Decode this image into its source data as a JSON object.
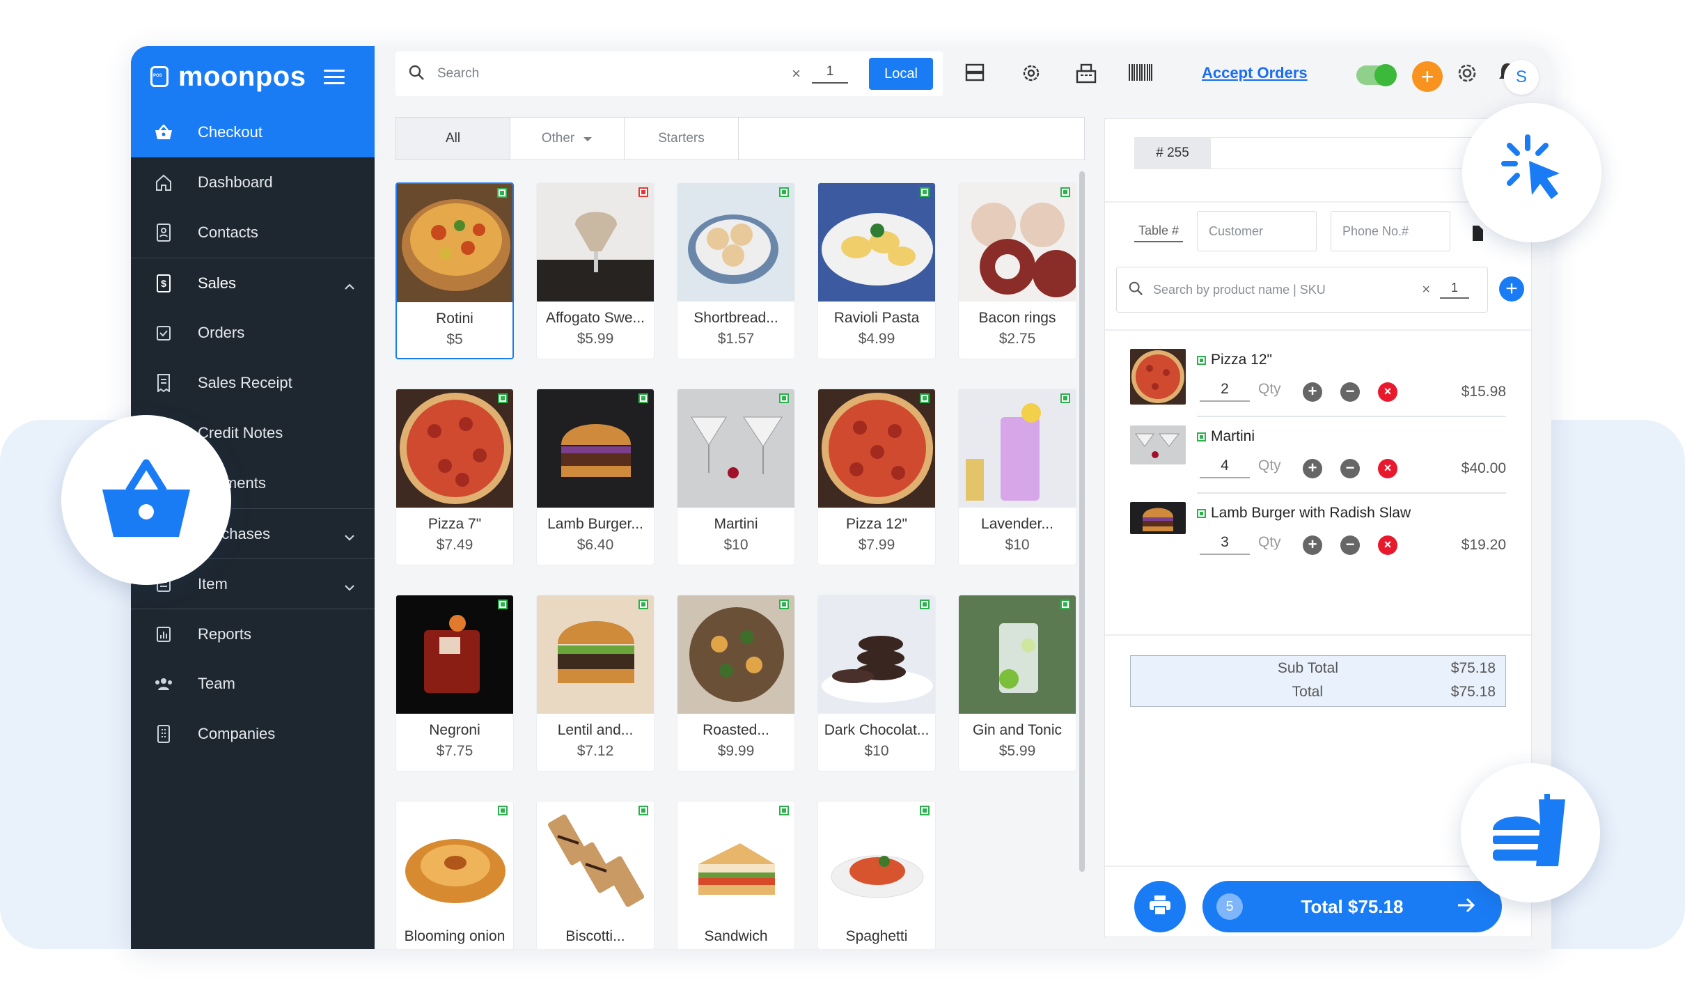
{
  "app": {
    "logo": "moonpos",
    "logo_badge": "POS"
  },
  "sidebar": {
    "items": [
      {
        "label": "Checkout",
        "icon": "basket-icon"
      },
      {
        "label": "Dashboard",
        "icon": "home-icon"
      },
      {
        "label": "Contacts",
        "icon": "contacts-icon"
      },
      {
        "label": "Sales",
        "icon": "dollar-doc-icon"
      },
      {
        "label": "Orders",
        "icon": "checkbox-icon"
      },
      {
        "label": "Sales Receipt",
        "icon": "receipt-icon"
      },
      {
        "label": "Credit Notes",
        "icon": "note-icon"
      },
      {
        "label": "Payments",
        "icon": "payments-icon"
      },
      {
        "label": "Purchases",
        "icon": "purchase-icon"
      },
      {
        "label": "Item",
        "icon": "item-icon"
      },
      {
        "label": "Reports",
        "icon": "chart-icon"
      },
      {
        "label": "Team",
        "icon": "team-icon"
      },
      {
        "label": "Companies",
        "icon": "building-icon"
      }
    ]
  },
  "topbar": {
    "search_placeholder": "Search",
    "search_qty": "1",
    "clear": "×",
    "local_label": "Local",
    "accept_orders": "Accept Orders",
    "avatar": "S",
    "plus": "+"
  },
  "categories": [
    "All",
    "Other",
    "Starters"
  ],
  "products": [
    {
      "name": "Rotini",
      "price": "$5",
      "veg": true
    },
    {
      "name": "Affogato Swe...",
      "price": "$5.99",
      "veg": false
    },
    {
      "name": "Shortbread...",
      "price": "$1.57",
      "veg": true
    },
    {
      "name": "Ravioli Pasta",
      "price": "$4.99",
      "veg": true
    },
    {
      "name": "Bacon rings",
      "price": "$2.75",
      "veg": true
    },
    {
      "name": "Pizza 7\"",
      "price": "$7.49",
      "veg": true
    },
    {
      "name": "Lamb Burger...",
      "price": "$6.40",
      "veg": true
    },
    {
      "name": "Martini",
      "price": "$10",
      "veg": true
    },
    {
      "name": "Pizza 12\"",
      "price": "$7.99",
      "veg": true
    },
    {
      "name": "Lavender...",
      "price": "$10",
      "veg": true
    },
    {
      "name": "Negroni",
      "price": "$7.75",
      "veg": true
    },
    {
      "name": "Lentil and...",
      "price": "$7.12",
      "veg": true
    },
    {
      "name": "Roasted...",
      "price": "$9.99",
      "veg": true
    },
    {
      "name": "Dark Chocolat...",
      "price": "$10",
      "veg": true
    },
    {
      "name": "Gin and Tonic",
      "price": "$5.99",
      "veg": true
    },
    {
      "name": "Blooming onion",
      "price": "",
      "veg": true
    },
    {
      "name": "Biscotti...",
      "price": "",
      "veg": true
    },
    {
      "name": "Sandwich",
      "price": "",
      "veg": true
    },
    {
      "name": "Spaghetti",
      "price": "",
      "veg": true
    }
  ],
  "cart": {
    "order_no": "# 255",
    "table_label": "Table #",
    "customer_placeholder": "Customer",
    "phone_placeholder": "Phone No.#",
    "product_search_placeholder": "Search by product name | SKU",
    "product_search_qty": "1",
    "clear": "×",
    "qty_label": "Qty",
    "items": [
      {
        "name": "Pizza 12\"",
        "qty": "2",
        "price": "$15.98"
      },
      {
        "name": "Martini",
        "qty": "4",
        "price": "$40.00"
      },
      {
        "name": "Lamb Burger with Radish Slaw",
        "qty": "3",
        "price": "$19.20"
      }
    ],
    "subtotal_label": "Sub Total",
    "subtotal_value": "$75.18",
    "total_label": "Total",
    "total_value": "$75.18",
    "item_count": "5",
    "total_button": "Total $75.18"
  },
  "colors": {
    "accent": "#1a7cf5",
    "sidebar": "#1e2730",
    "veg": "#2bb24c",
    "nonveg": "#e53935",
    "danger": "#e8192c"
  }
}
